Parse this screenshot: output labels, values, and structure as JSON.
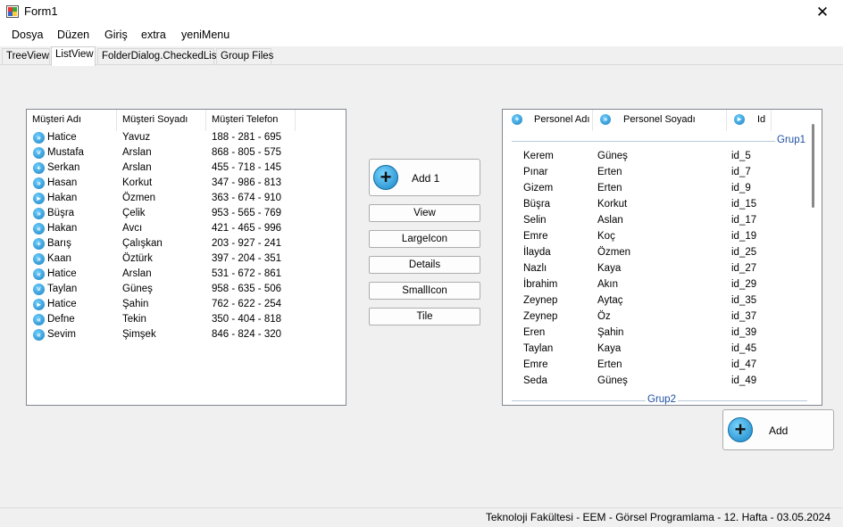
{
  "window": {
    "title": "Form1",
    "close_glyph": "✕"
  },
  "menu": [
    "Dosya",
    "Düzen",
    "Giriş",
    "extra",
    "yeniMenu"
  ],
  "tabs": [
    "TreeView",
    "ListView",
    "FolderDialog.CheckedList",
    "Group Files"
  ],
  "active_tab": "ListView",
  "customers": {
    "columns": [
      "Müşteri Adı",
      "Müşteri Soyadı",
      "Müşteri Telefon"
    ],
    "rows": [
      {
        "icon": "fast-forward-icon",
        "glyph": "»",
        "name": "Hatice",
        "surname": "Yavuz",
        "phone": "188 - 281 - 695"
      },
      {
        "icon": "chevron-down-icon",
        "glyph": "˅",
        "name": "Mustafa",
        "surname": "Arslan",
        "phone": "868 - 805 - 575"
      },
      {
        "icon": "plus-icon",
        "glyph": "+",
        "name": "Serkan",
        "surname": "Arslan",
        "phone": "455 - 718 - 145"
      },
      {
        "icon": "fast-forward-icon",
        "glyph": "»",
        "name": "Hasan",
        "surname": "Korkut",
        "phone": "347 - 986 - 813"
      },
      {
        "icon": "play-icon",
        "glyph": "▸",
        "name": "Hakan",
        "surname": "Özmen",
        "phone": "363 - 674 - 910"
      },
      {
        "icon": "fast-forward-icon",
        "glyph": "»",
        "name": "Büşra",
        "surname": "Çelik",
        "phone": "953 - 565 - 769"
      },
      {
        "icon": "rewind-icon",
        "glyph": "«",
        "name": "Hakan",
        "surname": "Avcı",
        "phone": "421 - 465 - 996"
      },
      {
        "icon": "plus-icon",
        "glyph": "+",
        "name": "Barış",
        "surname": "Çalışkan",
        "phone": "203 - 927 - 241"
      },
      {
        "icon": "fast-forward-icon",
        "glyph": "»",
        "name": "Kaan",
        "surname": "Öztürk",
        "phone": "397 - 204 - 351"
      },
      {
        "icon": "rewind-icon",
        "glyph": "«",
        "name": "Hatice",
        "surname": "Arslan",
        "phone": "531 - 672 - 861"
      },
      {
        "icon": "chevron-down-icon",
        "glyph": "˅",
        "name": "Taylan",
        "surname": "Güneş",
        "phone": "958 - 635 - 506"
      },
      {
        "icon": "play-icon",
        "glyph": "▸",
        "name": "Hatice",
        "surname": "Şahin",
        "phone": "762 - 622 - 254"
      },
      {
        "icon": "rewind-icon",
        "glyph": "«",
        "name": "Defne",
        "surname": "Tekin",
        "phone": "350 - 404 - 818"
      },
      {
        "icon": "rewind-icon",
        "glyph": "«",
        "name": "Sevim",
        "surname": "Şimşek",
        "phone": "846 - 824 - 320"
      }
    ]
  },
  "buttons": {
    "add1": "Add 1",
    "plus_glyph": "+",
    "view_modes": [
      "View",
      "LargeIcon",
      "Details",
      "SmallIcon",
      "Tile"
    ],
    "add": "Add"
  },
  "personnel": {
    "columns": [
      {
        "label": "Personel Adı",
        "icon": "plus-icon",
        "glyph": "+"
      },
      {
        "label": "Personel Soyadı",
        "icon": "fast-forward-icon",
        "glyph": "»"
      },
      {
        "label": "Id",
        "icon": "play-icon",
        "glyph": "▸"
      }
    ],
    "groups": [
      {
        "label": "Grup1",
        "rows": [
          {
            "name": "Kerem",
            "surname": "Güneş",
            "id": "id_5"
          },
          {
            "name": "Pınar",
            "surname": "Erten",
            "id": "id_7"
          },
          {
            "name": "Gizem",
            "surname": "Erten",
            "id": "id_9"
          },
          {
            "name": "Büşra",
            "surname": "Korkut",
            "id": "id_15"
          },
          {
            "name": "Selin",
            "surname": "Aslan",
            "id": "id_17"
          },
          {
            "name": "Emre",
            "surname": "Koç",
            "id": "id_19"
          },
          {
            "name": "İlayda",
            "surname": "Özmen",
            "id": "id_25"
          },
          {
            "name": "Nazlı",
            "surname": "Kaya",
            "id": "id_27"
          },
          {
            "name": "İbrahim",
            "surname": "Akın",
            "id": "id_29"
          },
          {
            "name": "Zeynep",
            "surname": "Aytaç",
            "id": "id_35"
          },
          {
            "name": "Zeynep",
            "surname": "Öz",
            "id": "id_37"
          },
          {
            "name": "Eren",
            "surname": "Şahin",
            "id": "id_39"
          },
          {
            "name": "Taylan",
            "surname": "Kaya",
            "id": "id_45"
          },
          {
            "name": "Emre",
            "surname": "Erten",
            "id": "id_47"
          },
          {
            "name": "Seda",
            "surname": "Güneş",
            "id": "id_49"
          }
        ]
      },
      {
        "label": "Grup2",
        "rows": []
      }
    ]
  },
  "status": "Teknoloji Fakültesi - EEM - Görsel Programlama - 12. Hafta - 03.05.2024"
}
